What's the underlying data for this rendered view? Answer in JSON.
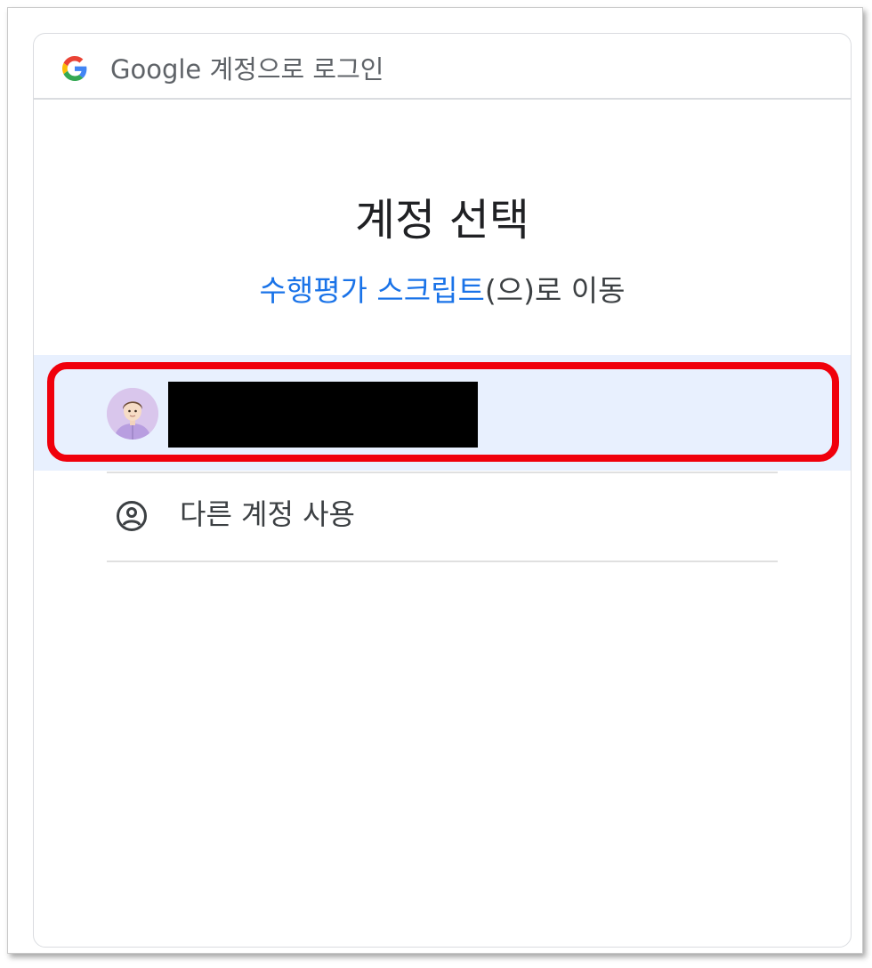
{
  "header": {
    "title": "Google 계정으로 로그인",
    "logo_icon": "google-g-icon"
  },
  "main": {
    "title": "계정 선택",
    "subtitle_app": "수행평가 스크립트",
    "subtitle_suffix": "(으)로 이동"
  },
  "accounts": [
    {
      "avatar_icon": "avatar-icon",
      "email_redacted": true
    }
  ],
  "other_account": {
    "icon": "person-circle-icon",
    "label": "다른 계정 사용"
  },
  "colors": {
    "link": "#1a73e8",
    "selected_row_bg": "#e8f0fe",
    "highlight_border": "#f0000c",
    "text_primary": "#202124",
    "text_secondary": "#5f6368"
  }
}
